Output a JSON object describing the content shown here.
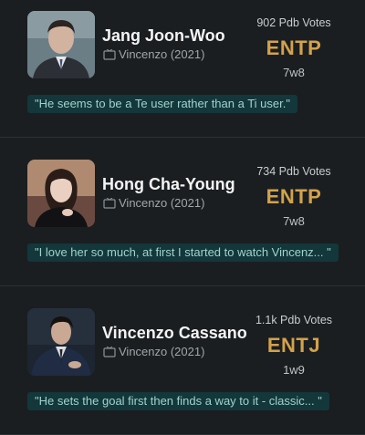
{
  "profiles": [
    {
      "name": "Jang Joon-Woo",
      "source": "Vincenzo (2021)",
      "votes": "902 Pdb Votes",
      "mbti": "ENTP",
      "enneagram": "7w8",
      "quote": "\"He seems to be a Te user rather than a Ti user.\""
    },
    {
      "name": "Hong Cha-Young",
      "source": "Vincenzo (2021)",
      "votes": "734 Pdb Votes",
      "mbti": "ENTP",
      "enneagram": "7w8",
      "quote": "\"I love her so much, at first I started to watch Vincenz... \""
    },
    {
      "name": "Vincenzo Cassano",
      "source": "Vincenzo (2021)",
      "votes": "1.1k Pdb Votes",
      "mbti": "ENTJ",
      "enneagram": "1w9",
      "quote": "\"He sets the goal first then finds a way to it - classic... \""
    }
  ],
  "colors": {
    "background": "#1a1e21",
    "accent_type": "#d4a24a",
    "quote_bg": "#13373a",
    "quote_text": "#9fd3cf"
  },
  "icons": {
    "source": "tv-icon"
  }
}
